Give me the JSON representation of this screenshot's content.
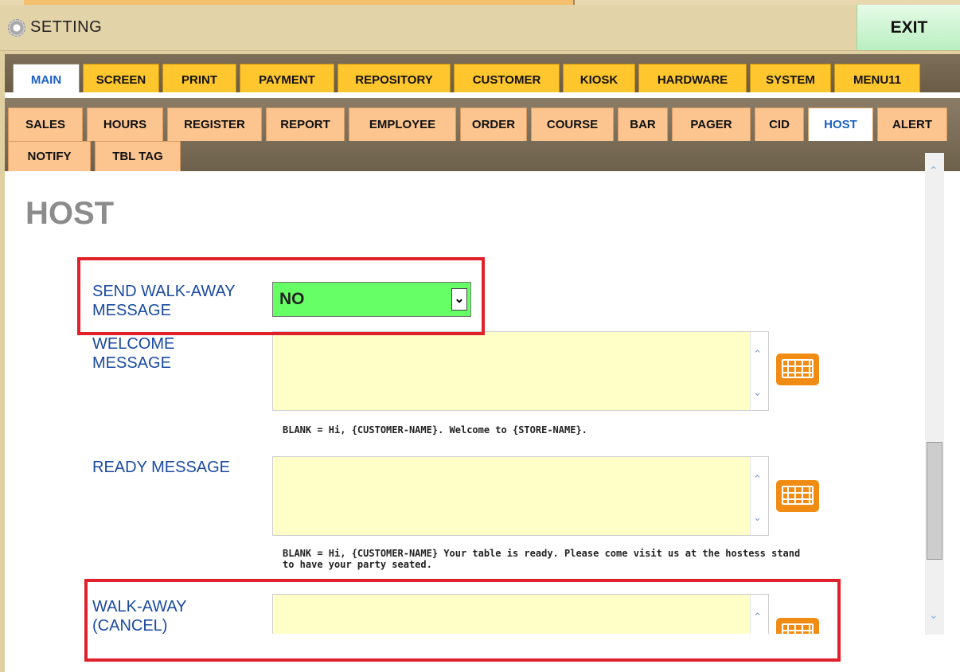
{
  "window": {
    "title": "SETTING",
    "exit_label": "EXIT"
  },
  "main_tabs": [
    "MAIN",
    "SCREEN",
    "PRINT",
    "PAYMENT",
    "REPOSITORY",
    "CUSTOMER",
    "KIOSK",
    "HARDWARE",
    "SYSTEM",
    "MENU11"
  ],
  "active_main_tab": "MAIN",
  "sub_tabs": [
    "SALES",
    "HOURS",
    "REGISTER",
    "REPORT",
    "EMPLOYEE",
    "ORDER",
    "COURSE",
    "BAR",
    "PAGER",
    "CID",
    "HOST",
    "ALERT",
    "NOTIFY",
    "TBL TAG"
  ],
  "active_sub_tab": "HOST",
  "page_title": "HOST",
  "fields": {
    "walk_away": {
      "label_line1": "SEND WALK-AWAY",
      "label_line2": "MESSAGE",
      "value": "NO"
    },
    "welcome": {
      "label_line1": "WELCOME",
      "label_line2": "MESSAGE",
      "value": "",
      "hint": "BLANK = Hi, {CUSTOMER-NAME}. Welcome to {STORE-NAME}."
    },
    "ready": {
      "label": "READY MESSAGE",
      "value": "",
      "hint_line1": "BLANK = Hi, {CUSTOMER-NAME} Your table is ready. Please come visit us at the hostess stand",
      "hint_line2": "to have your party seated."
    },
    "cancel": {
      "label_line1": "WALK-AWAY",
      "label_line2": "(CANCEL)",
      "value": ""
    }
  },
  "icons": {
    "settings": "gear-icon",
    "keyboard": "keyboard-icon",
    "scroll_up": "chevron-up-icon",
    "scroll_down": "chevron-down-icon",
    "dropdown": "chevron-down-icon"
  },
  "colors": {
    "select_bg": "#66ff66",
    "textarea_bg": "#ffffc8",
    "highlight": "#e0202a",
    "main_tab": "#ffc62e",
    "sub_tab": "#fcc590",
    "active_text": "#1c62c4",
    "exit_bg": "#b9efc0"
  }
}
